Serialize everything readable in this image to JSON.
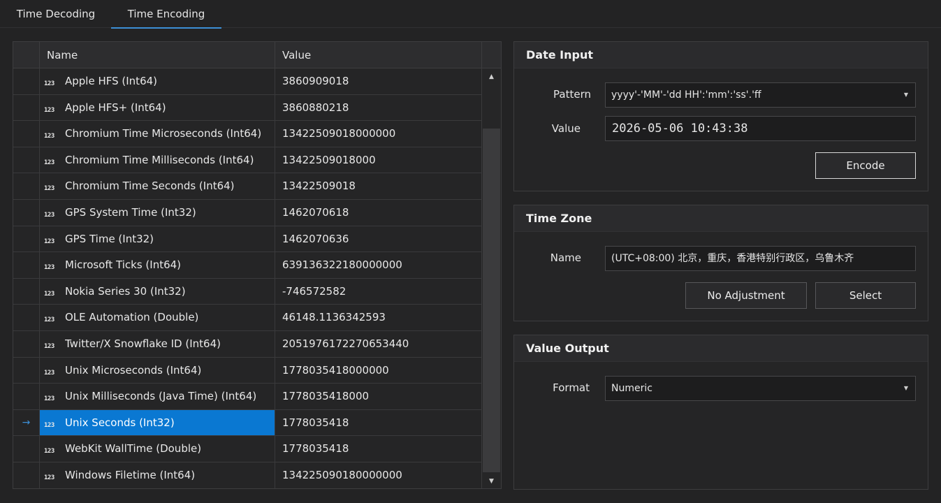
{
  "tabs": [
    "Time Decoding",
    "Time Encoding"
  ],
  "grid": {
    "headers": {
      "name": "Name",
      "value": "Value"
    },
    "rows": [
      {
        "name": "Apple HFS (Int64)",
        "value": "3860909018"
      },
      {
        "name": "Apple HFS+ (Int64)",
        "value": "3860880218"
      },
      {
        "name": "Chromium Time Microseconds (Int64)",
        "value": "13422509018000000"
      },
      {
        "name": "Chromium Time Milliseconds (Int64)",
        "value": "13422509018000"
      },
      {
        "name": "Chromium Time Seconds (Int64)",
        "value": "13422509018"
      },
      {
        "name": "GPS System Time (Int32)",
        "value": "1462070618"
      },
      {
        "name": "GPS Time (Int32)",
        "value": "1462070636"
      },
      {
        "name": "Microsoft Ticks (Int64)",
        "value": "639136322180000000"
      },
      {
        "name": "Nokia Series 30 (Int32)",
        "value": "-746572582"
      },
      {
        "name": "OLE Automation (Double)",
        "value": "46148.1136342593"
      },
      {
        "name": "Twitter/X Snowflake ID (Int64)",
        "value": "2051976172270653440"
      },
      {
        "name": "Unix Microseconds (Int64)",
        "value": "1778035418000000"
      },
      {
        "name": "Unix Milliseconds (Java Time) (Int64)",
        "value": "1778035418000"
      },
      {
        "name": "Unix Seconds (Int32)",
        "value": "1778035418"
      },
      {
        "name": "WebKit WallTime (Double)",
        "value": "1778035418"
      },
      {
        "name": "Windows Filetime (Int64)",
        "value": "134225090180000000"
      }
    ],
    "selected_index": 13,
    "current_row_glyph": "→",
    "number_icon": "123"
  },
  "date_input": {
    "title": "Date Input",
    "pattern_label": "Pattern",
    "pattern_value": "yyyy'-'MM'-'dd HH':'mm':'ss'.'ff",
    "value_label": "Value",
    "value": "2026-05-06 10:43:38",
    "encode_label": "Encode"
  },
  "time_zone": {
    "title": "Time Zone",
    "name_label": "Name",
    "name_value": "(UTC+08:00) 北京，重庆，香港特别行政区，乌鲁木齐",
    "no_adjust_label": "No Adjustment",
    "select_label": "Select"
  },
  "value_output": {
    "title": "Value Output",
    "format_label": "Format",
    "format_value": "Numeric"
  },
  "icons": {
    "dropdown": "chevron-down-icon",
    "scroll_up": "scroll-up-icon",
    "scroll_down": "scroll-down-icon"
  },
  "colors": {
    "accent": "#0a78d2",
    "tab_underline": "#3c8fd6",
    "background": "#232324"
  }
}
